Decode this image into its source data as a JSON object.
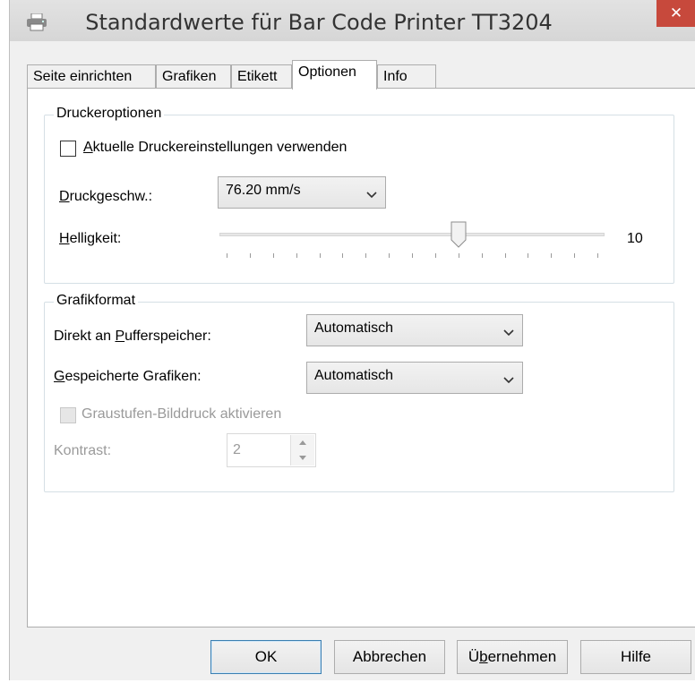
{
  "window": {
    "title": "Standardwerte für Bar Code Printer TT3204",
    "close_label": "✕"
  },
  "tabs": [
    {
      "label": "Seite einrichten",
      "active": false
    },
    {
      "label": "Grafiken",
      "active": false
    },
    {
      "label": "Etikett",
      "active": false
    },
    {
      "label": "Optionen",
      "active": true
    },
    {
      "label": "Info",
      "active": false
    }
  ],
  "printer_options": {
    "group_title": "Druckeroptionen",
    "use_current_settings": {
      "label_prefix": "",
      "label_underline": "A",
      "label_rest": "ktuelle Druckereinstellungen verwenden",
      "checked": false
    },
    "print_speed": {
      "label_underline": "D",
      "label_rest": "ruckgeschw.:",
      "value": "76.20 mm/s"
    },
    "brightness": {
      "label_underline": "H",
      "label_rest": "elligkeit:",
      "value_text": "10",
      "value": 10,
      "min": 0,
      "max": 16
    }
  },
  "graphics_format": {
    "group_title": "Grafikformat",
    "direct_buffer": {
      "label_prefix": "Direkt an ",
      "label_underline": "P",
      "label_rest": "ufferspeicher:",
      "value": "Automatisch"
    },
    "stored_graphics": {
      "label_underline": "G",
      "label_rest": "espeicherte Grafiken:",
      "value": "Automatisch"
    },
    "grayscale": {
      "label": "Graustufen-Bilddruck aktivieren",
      "checked": false,
      "enabled": false
    },
    "contrast": {
      "label": "Kontrast:",
      "value": "2",
      "enabled": false
    }
  },
  "buttons": {
    "ok": "OK",
    "cancel": "Abbrechen",
    "apply_prefix": "Ü",
    "apply_underline": "b",
    "apply_rest": "ernehmen",
    "help": "Hilfe"
  },
  "colors": {
    "close_button": "#c7493c",
    "default_button_border": "#3c7fb1"
  }
}
